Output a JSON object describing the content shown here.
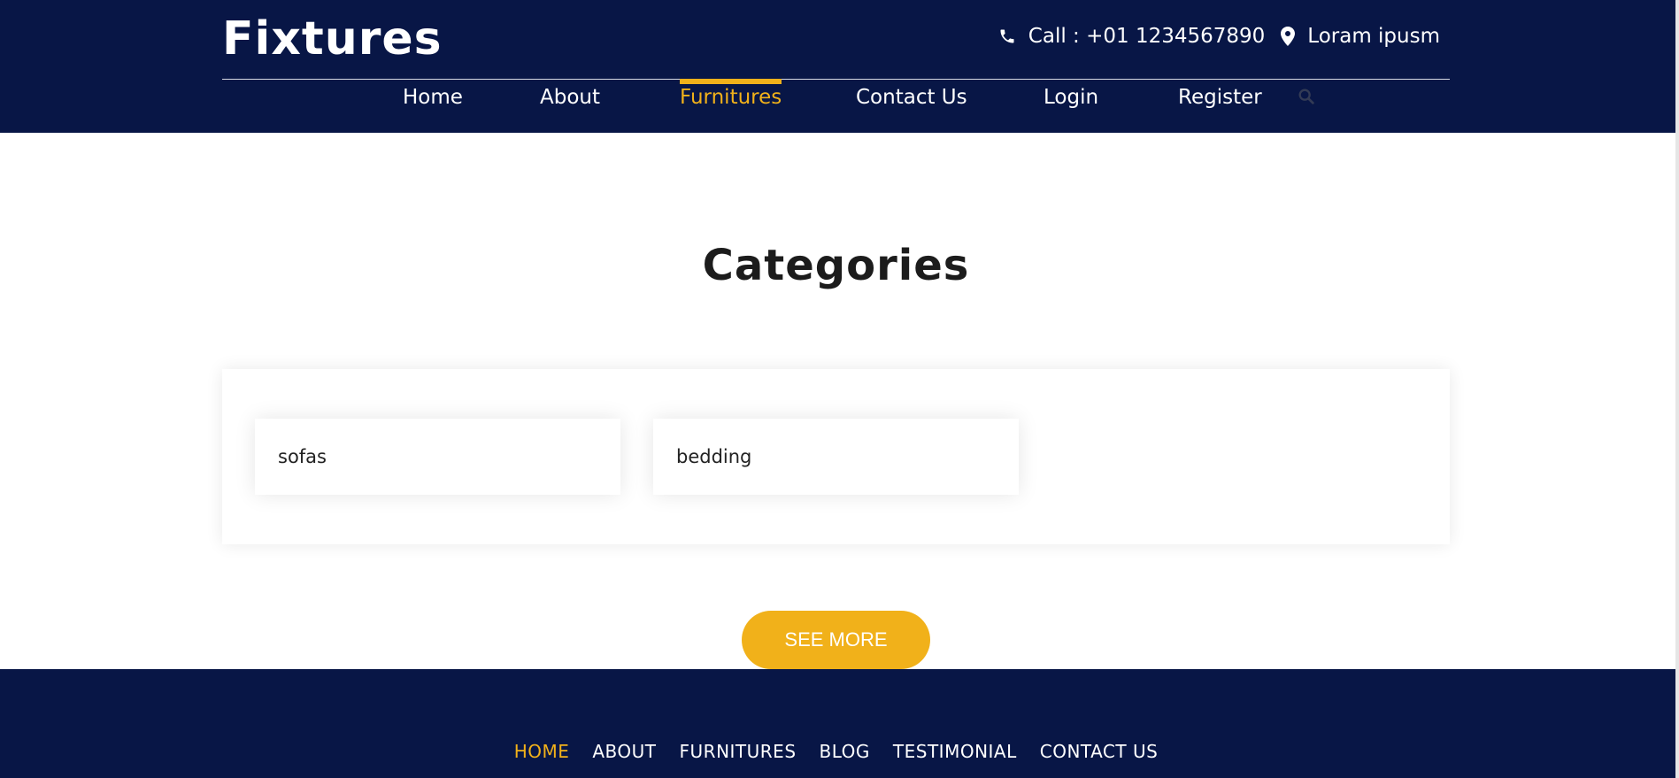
{
  "brand": {
    "name": "Fixtures"
  },
  "header": {
    "call_text": "Call : +01 1234567890",
    "location_text": "Loram ipusm"
  },
  "nav": {
    "items": [
      "Home",
      "About",
      "Furnitures",
      "Contact Us",
      "Login",
      "Register"
    ],
    "active_index": 2
  },
  "main": {
    "title": "Categories",
    "categories": [
      "sofas",
      "bedding"
    ],
    "see_more_label": "SEE MORE"
  },
  "footer": {
    "links": [
      "HOME",
      "ABOUT",
      "FURNITURES",
      "BLOG",
      "TESTIMONIAL",
      "CONTACT US"
    ],
    "active_index": 0
  },
  "icons": {
    "phone": "phone-icon",
    "location": "map-pin-icon",
    "search": "search-icon"
  },
  "colors": {
    "navy": "#081646",
    "accent": "#f1b11a"
  }
}
